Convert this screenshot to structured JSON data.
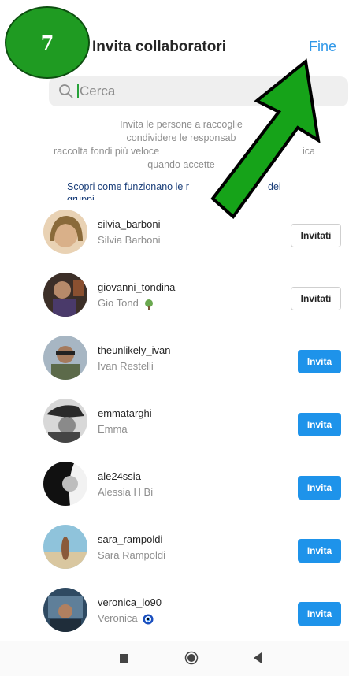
{
  "step_badge": "7",
  "header": {
    "title": "Invita collaboratori",
    "done_label": "Fine"
  },
  "search": {
    "placeholder": "Cerca"
  },
  "description": {
    "lines": [
      "Invita le persone a raccoglie",
      "condividere le responsab",
      "raccolta fondi più veloce",
      "quando accette"
    ],
    "line3_right": "ica",
    "learn_more": "Scopri come funzionano le r",
    "learn_more_tail": "dei",
    "learn_more_line2": "gruppi"
  },
  "users": [
    {
      "username": "silvia_barboni",
      "fullname": "Silvia Barboni",
      "button": "Invitati",
      "state": "invited",
      "avatar_color": "#c8a37a",
      "emoji": ""
    },
    {
      "username": "giovanni_tondina",
      "fullname": "Gio Tond",
      "button": "Invitati",
      "state": "invited",
      "avatar_color": "#5a3d2e",
      "emoji": "tree"
    },
    {
      "username": "theunlikely_ivan",
      "fullname": "Ivan Restelli",
      "button": "Invita",
      "state": "invite",
      "avatar_color": "#7b8f6a",
      "emoji": ""
    },
    {
      "username": "emmatarghi",
      "fullname": "Emma",
      "button": "Invita",
      "state": "invite",
      "avatar_color": "#4a4a4a",
      "emoji": ""
    },
    {
      "username": "ale24ssia",
      "fullname": "Alessia H Bi",
      "button": "Invita",
      "state": "invite",
      "avatar_color": "#2a2a2a",
      "emoji": ""
    },
    {
      "username": "sara_rampoldi",
      "fullname": "Sara Rampoldi",
      "button": "Invita",
      "state": "invite",
      "avatar_color": "#6aa0b8",
      "emoji": ""
    },
    {
      "username": "veronica_lo90",
      "fullname": "Veronica",
      "button": "Invita",
      "state": "invite",
      "avatar_color": "#3a5a7a",
      "emoji": "eye"
    }
  ],
  "colors": {
    "accent": "#1e93ea",
    "link": "#2f97e8",
    "badge": "#1f9b22",
    "arrow": "#16a319"
  }
}
